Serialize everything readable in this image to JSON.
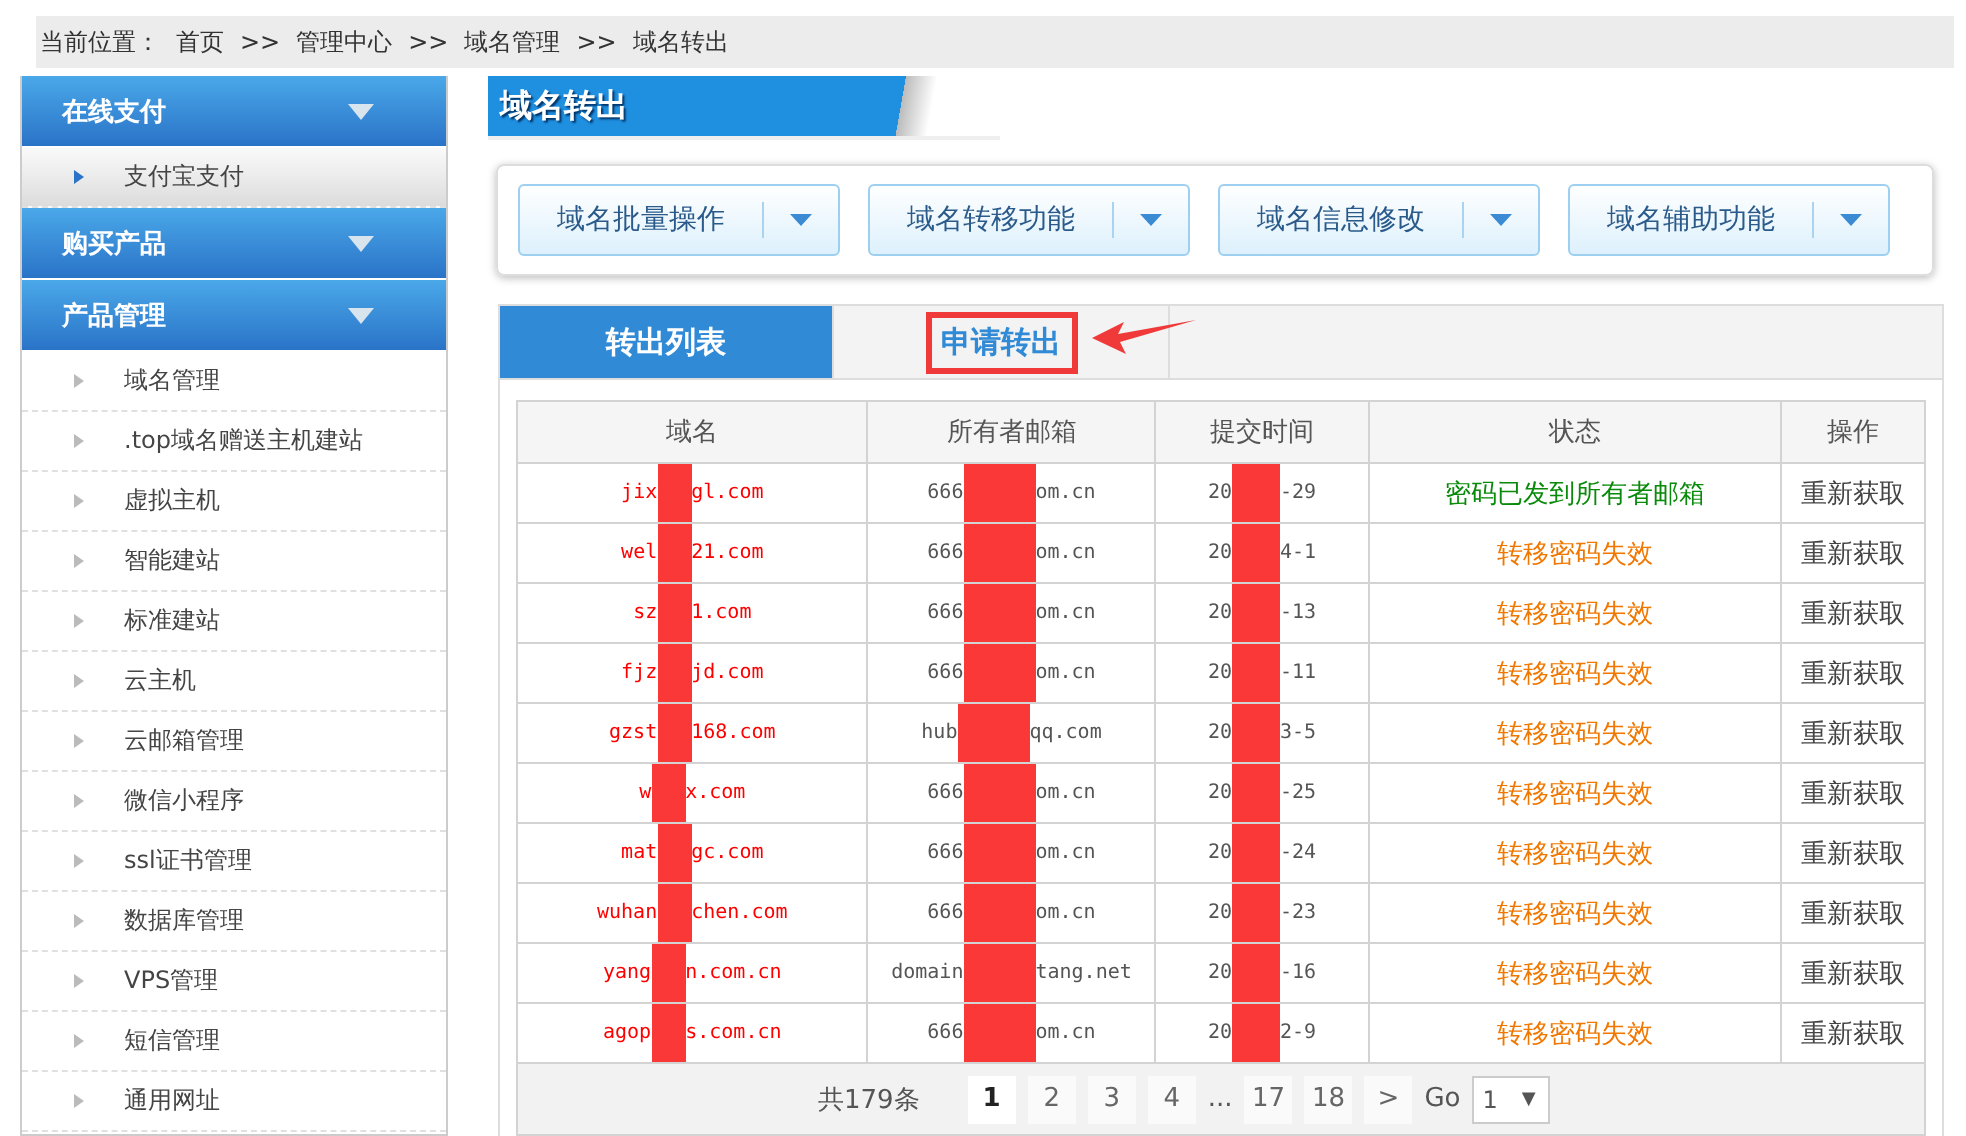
{
  "breadcrumb": {
    "label": "当前位置：",
    "items": [
      "首页",
      "管理中心",
      "域名管理",
      "域名转出"
    ],
    "separator": ">>"
  },
  "sidebar": {
    "groups": [
      {
        "title": "在线支付",
        "items": [
          {
            "label": "支付宝支付",
            "selected": true
          }
        ]
      },
      {
        "title": "购买产品"
      },
      {
        "title": "产品管理",
        "items": [
          {
            "label": "域名管理",
            "selected": false
          },
          {
            "label": ".top域名赠送主机建站",
            "selected": false
          },
          {
            "label": "虚拟主机",
            "selected": false
          },
          {
            "label": "智能建站",
            "selected": false
          },
          {
            "label": "标准建站",
            "selected": false
          },
          {
            "label": "云主机",
            "selected": false
          },
          {
            "label": "云邮箱管理",
            "selected": false
          },
          {
            "label": "微信小程序",
            "selected": false
          },
          {
            "label": "ssl证书管理",
            "selected": false
          },
          {
            "label": "数据库管理",
            "selected": false
          },
          {
            "label": "VPS管理",
            "selected": false
          },
          {
            "label": "短信管理",
            "selected": false
          },
          {
            "label": "通用网址",
            "selected": false
          }
        ]
      }
    ]
  },
  "page_title": "域名转出",
  "toolbar": [
    "域名批量操作",
    "域名转移功能",
    "域名信息修改",
    "域名辅助功能"
  ],
  "tabs": [
    {
      "label": "转出列表",
      "selected": true,
      "highlighted": false
    },
    {
      "label": "申请转出",
      "selected": false,
      "highlighted": true
    }
  ],
  "table": {
    "columns": [
      "域名",
      "所有者邮箱",
      "提交时间",
      "状态",
      "操作"
    ],
    "rows": [
      {
        "domain": [
          "jix",
          "gl.com"
        ],
        "email": [
          "666",
          "om.cn"
        ],
        "time": [
          "20",
          "-29"
        ],
        "status": "密码已发到所有者邮箱",
        "color": "#0a8a0a",
        "action": "重新获取"
      },
      {
        "domain": [
          "wel",
          "21.com"
        ],
        "email": [
          "666",
          "om.cn"
        ],
        "time": [
          "20",
          "4-1"
        ],
        "status": "转移密码失效",
        "color": "#f07800",
        "action": "重新获取"
      },
      {
        "domain": [
          "sz",
          "1.com"
        ],
        "email": [
          "666",
          "om.cn"
        ],
        "time": [
          "20",
          "-13"
        ],
        "status": "转移密码失效",
        "color": "#f07800",
        "action": "重新获取"
      },
      {
        "domain": [
          "fjz",
          "jd.com"
        ],
        "email": [
          "666",
          "om.cn"
        ],
        "time": [
          "20",
          "-11"
        ],
        "status": "转移密码失效",
        "color": "#f07800",
        "action": "重新获取"
      },
      {
        "domain": [
          "gzst",
          "168.com"
        ],
        "email": [
          "hub",
          "qq.com"
        ],
        "time": [
          "20",
          "3-5"
        ],
        "status": "转移密码失效",
        "color": "#f07800",
        "action": "重新获取"
      },
      {
        "domain": [
          "w",
          "x.com"
        ],
        "email": [
          "666",
          "om.cn"
        ],
        "time": [
          "20",
          "-25"
        ],
        "status": "转移密码失效",
        "color": "#f07800",
        "action": "重新获取"
      },
      {
        "domain": [
          "mat",
          "gc.com"
        ],
        "email": [
          "666",
          "om.cn"
        ],
        "time": [
          "20",
          "-24"
        ],
        "status": "转移密码失效",
        "color": "#f07800",
        "action": "重新获取"
      },
      {
        "domain": [
          "wuhan",
          "chen.com"
        ],
        "email": [
          "666",
          "om.cn"
        ],
        "time": [
          "20",
          "-23"
        ],
        "status": "转移密码失效",
        "color": "#f07800",
        "action": "重新获取"
      },
      {
        "domain": [
          "yang",
          "n.com.cn"
        ],
        "email": [
          "domain",
          "tang.net"
        ],
        "time": [
          "20",
          "-16"
        ],
        "status": "转移密码失效",
        "color": "#f07800",
        "action": "重新获取"
      },
      {
        "domain": [
          "agop",
          "s.com.cn"
        ],
        "email": [
          "666",
          "om.cn"
        ],
        "time": [
          "20",
          "2-9"
        ],
        "status": "转移密码失效",
        "color": "#f07800",
        "action": "重新获取"
      }
    ]
  },
  "pagination": {
    "total": "共179条",
    "pages": [
      {
        "label": "1",
        "selected": true
      },
      {
        "label": "2",
        "selected": false
      },
      {
        "label": "3",
        "selected": false
      },
      {
        "label": "4",
        "selected": false
      },
      {
        "label": "...",
        "kind": "gap"
      },
      {
        "label": "17",
        "selected": false
      },
      {
        "label": "18",
        "selected": false
      }
    ],
    "next": ">",
    "go_label": "Go",
    "go_value": "1",
    "go_caret": "▼"
  }
}
